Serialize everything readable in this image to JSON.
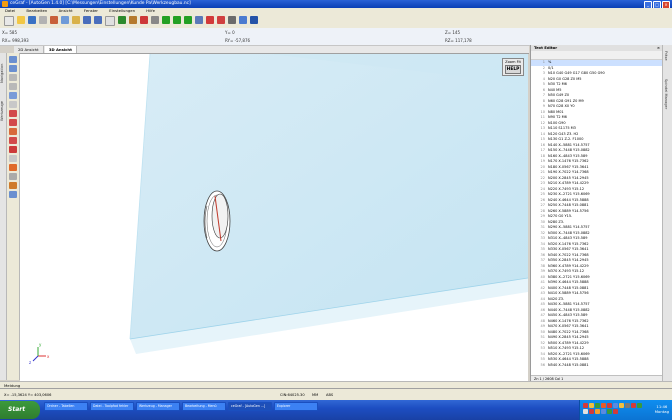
{
  "window": {
    "title": "ceGraf - [AutoGen 1.4.0] [C:\\Messungen\\Einstellungen\\Kunde Pa\\Werkzeugbau.nc]"
  },
  "menu": [
    "Datei",
    "Bearbeiten",
    "Ansicht",
    "Fenster",
    "Einstellungen",
    "Hilfe"
  ],
  "coords": {
    "x": "X= 585",
    "y": "Y= 0",
    "z": "Z= 145",
    "rx": "RX= 998,393",
    "ry": "RY= -57,876",
    "rz": "RZ= 117,178"
  },
  "tabs": [
    "2D Ansicht",
    "3D Ansicht"
  ],
  "left_tabs": [
    "Navigation",
    "Werkzeuge"
  ],
  "viewport": {
    "zoom_label": "Zoom Fit",
    "help_label": "HELP",
    "axis_x": "x",
    "axis_y": "y",
    "axis_z": "z"
  },
  "editor": {
    "title": "Text Editor",
    "close": "×",
    "status": "Zn 1 / 2608  Col 1",
    "lines": [
      {
        "n": "1",
        "t": "%"
      },
      {
        "n": "2",
        "t": "0/1"
      },
      {
        "n": "3",
        "t": "N10 G40 G49 G17 G80 G50 G90"
      },
      {
        "n": "4",
        "t": "N20 G0 G28 Z0 M5"
      },
      {
        "n": "5",
        "t": "N30 T2 M6"
      },
      {
        "n": "6",
        "t": "N40 M5"
      },
      {
        "n": "7",
        "t": "N50 G49 Z0"
      },
      {
        "n": "8",
        "t": "N60 G28 G91 Z0 M9"
      },
      {
        "n": "9",
        "t": "N70 G28 X0 Y0"
      },
      {
        "n": "10",
        "t": "N80 M01"
      },
      {
        "n": "11",
        "t": "N90 T2 M6"
      },
      {
        "n": "12",
        "t": "N100 G90"
      },
      {
        "n": "13",
        "t": "N110 S1175 M3"
      },
      {
        "n": "14",
        "t": "N120 G43 Z3. H2"
      },
      {
        "n": "15",
        "t": "N130 G1 Z-2. F1000"
      },
      {
        "n": "16",
        "t": "N140 X-.5881 Y14.5757"
      },
      {
        "n": "17",
        "t": "N150 X-.7448 Y15.0882"
      },
      {
        "n": "18",
        "t": "N160 X-.4843 Y15.589"
      },
      {
        "n": "19",
        "t": "N170 X.1476 Y15.7362"
      },
      {
        "n": "20",
        "t": "N180 X.0567 Y15.3641"
      },
      {
        "n": "21",
        "t": "N190 X.7022 Y14.7368"
      },
      {
        "n": "22",
        "t": "N200 X.2845 Y14.2945"
      },
      {
        "n": "23",
        "t": "N210 X.4789 Y14.4229"
      },
      {
        "n": "24",
        "t": "N220 X.7493 Y15.12"
      },
      {
        "n": "25",
        "t": "N230 X-.2721 Y15.6069"
      },
      {
        "n": "26",
        "t": "N240 X.4644 Y15.5888"
      },
      {
        "n": "27",
        "t": "N250 X.7448 Y15.0881"
      },
      {
        "n": "28",
        "t": "N260 X.5889 Y14.5756"
      },
      {
        "n": "29",
        "t": "N270 G0 Y15."
      },
      {
        "n": "30",
        "t": "N280 Z3."
      },
      {
        "n": "31",
        "t": "N290 X-.5881 Y14.5757"
      },
      {
        "n": "32",
        "t": "N300 X-.7448 Y15.0882"
      },
      {
        "n": "33",
        "t": "N310 X-.4843 Y15.589"
      },
      {
        "n": "34",
        "t": "N320 X.1476 Y15.7362"
      },
      {
        "n": "35",
        "t": "N330 X.0567 Y15.3641"
      },
      {
        "n": "36",
        "t": "N340 X.7022 Y14.7368"
      },
      {
        "n": "37",
        "t": "N350 X.2845 Y14.2945"
      },
      {
        "n": "38",
        "t": "N360 X.4789 Y14.4229"
      },
      {
        "n": "39",
        "t": "N370 X.7493 Y15.12"
      },
      {
        "n": "40",
        "t": "N380 X-.2721 Y15.6069"
      },
      {
        "n": "41",
        "t": "N390 X.4644 Y15.5888"
      },
      {
        "n": "42",
        "t": "N400 X.7448 Y15.0881"
      },
      {
        "n": "43",
        "t": "N410 X.5889 Y14.5756"
      },
      {
        "n": "44",
        "t": "N420 Z3."
      },
      {
        "n": "45",
        "t": "N430 X-.5881 Y14.5757"
      },
      {
        "n": "46",
        "t": "N440 X-.7448 Y15.0882"
      },
      {
        "n": "47",
        "t": "N450 X-.4843 Y15.589"
      },
      {
        "n": "48",
        "t": "N460 X.1476 Y15.7362"
      },
      {
        "n": "49",
        "t": "N470 X.0567 Y15.3641"
      },
      {
        "n": "50",
        "t": "N480 X.7022 Y14.7368"
      },
      {
        "n": "51",
        "t": "N490 X.2845 Y14.2945"
      },
      {
        "n": "52",
        "t": "N500 X.4789 Y14.4229"
      },
      {
        "n": "53",
        "t": "N510 X.7493 Y15.12"
      },
      {
        "n": "54",
        "t": "N520 X-.2721 Y15.6069"
      },
      {
        "n": "55",
        "t": "N530 X.4644 Y15.5888"
      },
      {
        "n": "56",
        "t": "N540 X.7448 Y15.0881"
      }
    ]
  },
  "right_tabs": [
    "Fräse",
    "Spindel Manager"
  ],
  "message_tab": "Meldung",
  "status": {
    "left": "X= -15,3624  Y= 403,0606",
    "mid": "CIN:64025.30",
    "unit": "MM",
    "val": "ABS"
  },
  "taskbar": {
    "start": "Start",
    "tasks": [
      "Ordner - Tabellen",
      "Datei - Toolpfad fehler",
      "Werkzeug - Manager",
      "Bearbeitung - Menü",
      "ceGraf - [AutoGen ...]",
      "Explorer"
    ],
    "active_task": 4,
    "time": "11:46",
    "day": "Montag"
  }
}
